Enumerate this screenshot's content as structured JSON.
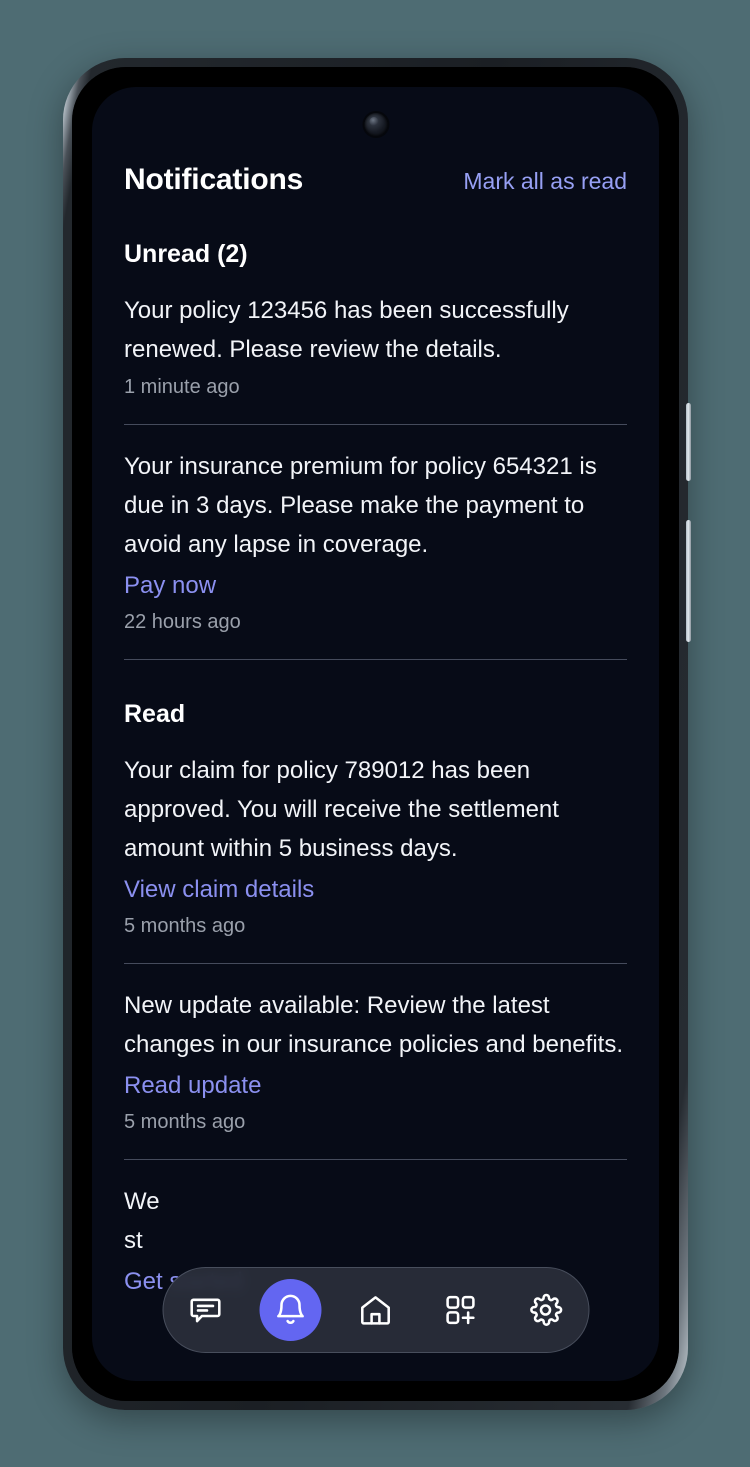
{
  "app": {
    "header": {
      "title": "Notifications",
      "mark_all_label": "Mark all as read"
    },
    "sections": [
      {
        "heading": "Unread (2)",
        "notifications": [
          {
            "body": "Your policy 123456 has been successfully renewed. Please review the details.",
            "action": null,
            "time": "1 minute ago"
          },
          {
            "body": "Your insurance premium for policy 654321 is due in 3 days. Please make the payment to avoid any lapse in coverage.",
            "action": "Pay now",
            "time": "22 hours ago"
          }
        ]
      },
      {
        "heading": "Read",
        "notifications": [
          {
            "body": "Your claim for policy 789012 has been approved. You will receive the settlement amount within 5 business days.",
            "action": "View claim details",
            "time": "5 months ago"
          },
          {
            "body": "New update available: Review the latest changes in our insurance policies and benefits.",
            "action": "Read update",
            "time": "5 months ago"
          },
          {
            "body": "We\nst",
            "action": "Get started",
            "time": ""
          }
        ]
      }
    ],
    "bottom_nav": {
      "items": [
        {
          "icon": "chat-bubble-icon",
          "active": false
        },
        {
          "icon": "bell-icon",
          "active": true
        },
        {
          "icon": "home-icon",
          "active": false
        },
        {
          "icon": "grid-plus-icon",
          "active": false
        },
        {
          "icon": "gear-icon",
          "active": false
        }
      ]
    },
    "colors": {
      "screen_background": "#070b17",
      "accent": "#6366f1",
      "link": "#8b90f0",
      "mark_all": "#97a0f4",
      "body_text": "#f2f4f8",
      "muted_text": "#9aa0ab",
      "divider": "#454b5c",
      "page_backdrop": "#4e6c73"
    }
  }
}
